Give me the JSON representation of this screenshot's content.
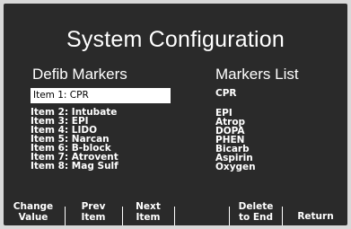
{
  "title": "System Configuration",
  "left_heading": "Defib Markers",
  "right_heading": "Markers List",
  "items": [
    "Item 1: CPR",
    "Item 2: Intubate",
    "Item 3: EPI",
    "Item 4: LIDO",
    "Item 5: Narcan",
    "Item 6: B-block",
    "Item 7: Atrovent",
    "Item 8: Mag Sulf"
  ],
  "selected_item_index": 0,
  "markers": [
    "CPR",
    "EPI",
    "Atrop",
    "DOPA",
    "PHEN",
    "Bicarb",
    "Aspirin",
    "Oxygen"
  ],
  "softkeys": [
    {
      "line1": "Change",
      "line2": "Value"
    },
    {
      "line1": "Prev",
      "line2": "Item"
    },
    {
      "line1": "Next",
      "line2": "Item"
    },
    {
      "line1": "",
      "line2": ""
    },
    {
      "line1": "Delete",
      "line2": "to End"
    },
    {
      "line1": "Return",
      "line2": ""
    }
  ],
  "colors": {
    "screen_bg": "#2a2a2a",
    "text": "#ffffff",
    "selection_bg": "#ffffff",
    "bezel": "#d9d9d9"
  }
}
